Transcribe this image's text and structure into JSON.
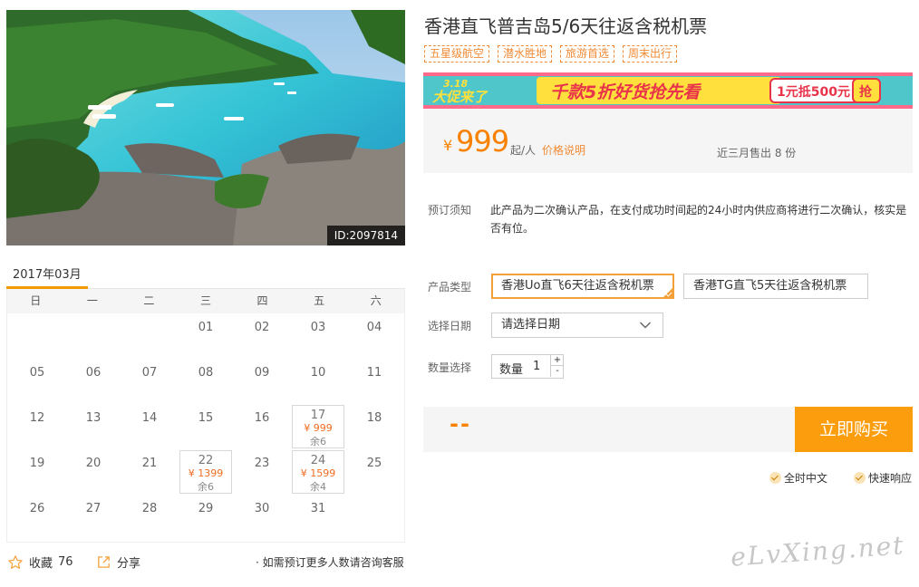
{
  "hero": {
    "image_id": "ID:2097814"
  },
  "product": {
    "title": "香港直飞普吉岛5/6天往返含税机票",
    "tags": [
      "五星级航空",
      "潜水胜地",
      "旅游首选",
      "周末出行"
    ]
  },
  "banner": {
    "date_text": "3.18",
    "promo_text": "大促来了",
    "headline": "千款5折好货抢先看",
    "coupon": "1元抵500元",
    "grab": "抢"
  },
  "price": {
    "currency": "¥",
    "amount": "999",
    "unit": "起/人",
    "note_link": "价格说明",
    "sold": "近三月售出 8 份"
  },
  "booking_notice": {
    "label": "预订须知",
    "text": "此产品为二次确认产品，在支付成功时间起的24小时内供应商将进行二次确认，核实是否有位。"
  },
  "product_type": {
    "label": "产品类型",
    "options": [
      "香港Uo直飞6天往返含税机票",
      "香港TG直飞5天往返含税机票"
    ],
    "selected_index": 0
  },
  "date_select": {
    "label": "选择日期",
    "placeholder": "请选择日期"
  },
  "quantity": {
    "label": "数量选择",
    "field_label": "数量",
    "value": "1",
    "plus": "+",
    "minus": "-"
  },
  "order": {
    "total": "--",
    "buy_label": "立即购买"
  },
  "services": [
    "全时中文",
    "快速响应"
  ],
  "calendar": {
    "month": "2017年03月",
    "weekdays": [
      "日",
      "一",
      "二",
      "三",
      "四",
      "五",
      "六"
    ],
    "weeks": [
      [
        {
          "d": ""
        },
        {
          "d": ""
        },
        {
          "d": ""
        },
        {
          "d": "01"
        },
        {
          "d": "02"
        },
        {
          "d": "03"
        },
        {
          "d": "04"
        }
      ],
      [
        {
          "d": "05"
        },
        {
          "d": "06"
        },
        {
          "d": "07"
        },
        {
          "d": "08"
        },
        {
          "d": "09"
        },
        {
          "d": "10"
        },
        {
          "d": "11"
        }
      ],
      [
        {
          "d": "12"
        },
        {
          "d": "13"
        },
        {
          "d": "14"
        },
        {
          "d": "15"
        },
        {
          "d": "16"
        },
        {
          "d": "17",
          "p": "¥ 999",
          "s": "余6"
        },
        {
          "d": "18"
        }
      ],
      [
        {
          "d": "19"
        },
        {
          "d": "20"
        },
        {
          "d": "21"
        },
        {
          "d": "22",
          "p": "¥ 1399",
          "s": "余6"
        },
        {
          "d": "23"
        },
        {
          "d": "24",
          "p": "¥ 1599",
          "s": "余4"
        },
        {
          "d": "25"
        }
      ],
      [
        {
          "d": "26"
        },
        {
          "d": "27"
        },
        {
          "d": "28"
        },
        {
          "d": "29"
        },
        {
          "d": "30"
        },
        {
          "d": "31"
        },
        {
          "d": ""
        }
      ]
    ]
  },
  "actions": {
    "favorite_label": "收藏",
    "favorite_count": "76",
    "share_label": "分享",
    "contact_notice": "· 如需预订更多人数请咨询客服"
  },
  "watermark": "eLvXing.net",
  "colors": {
    "accent": "#f88200",
    "button": "#fc9d0d",
    "tag": "#f08a35"
  }
}
